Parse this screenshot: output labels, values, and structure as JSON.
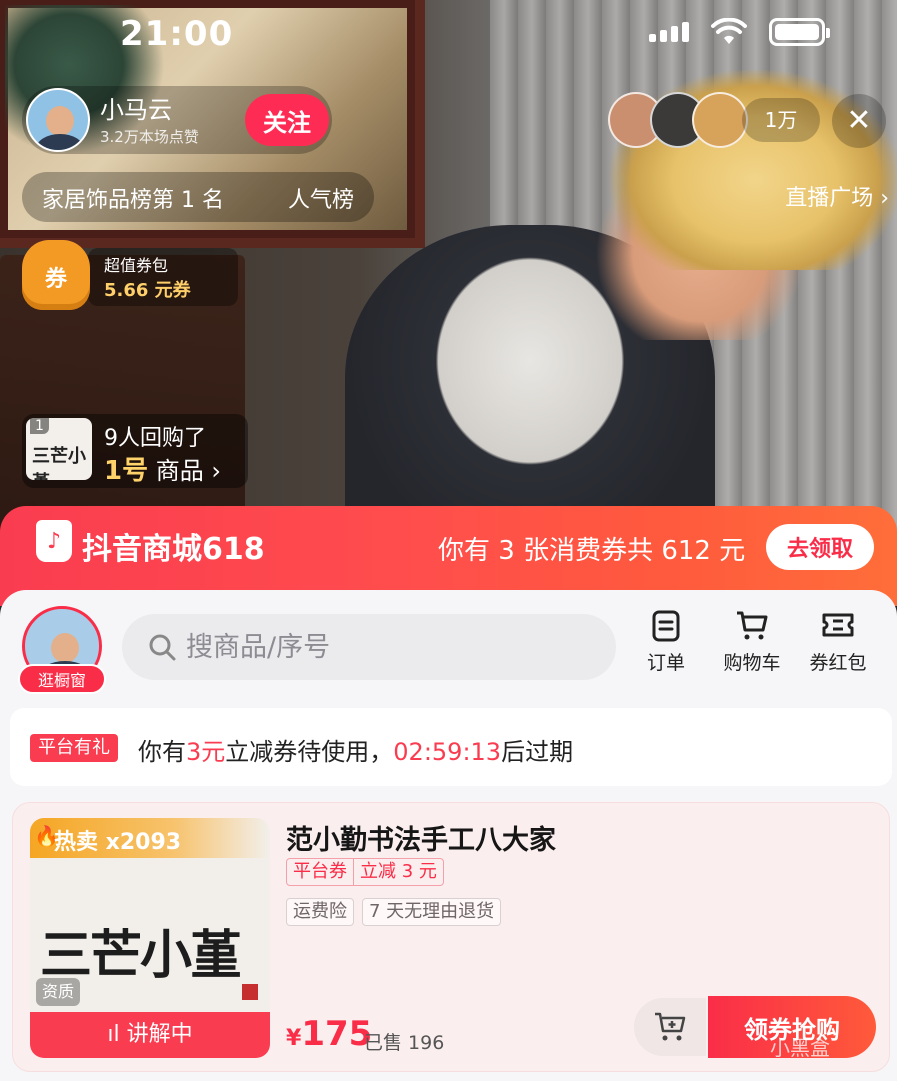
{
  "status_bar": {
    "time": "21:00"
  },
  "host": {
    "name": "小马云",
    "likes": "3.2万本场点赞",
    "follow_label": "关注"
  },
  "viewers": {
    "count": "1万"
  },
  "close_label": "✕",
  "rank": {
    "text": "家居饰品榜第 1 名",
    "popularity": "人气榜"
  },
  "plaza": "直播广场 ›",
  "coupon_pack": {
    "badge": "券",
    "title": "超值券包",
    "value": "5.66 元券"
  },
  "rebuy": {
    "thumb_num": "1",
    "thumb_ink": "三芒小堇",
    "line1": "9人回购了",
    "line2_highlight": "1号",
    "line2_rest": " 商品 ›"
  },
  "shop": {
    "name": "抖音商城618",
    "coupon_text": "你有 3 张消费券共 612 元",
    "collect_label": "去领取",
    "browse_label": "逛橱窗",
    "search_placeholder": "搜商品/序号",
    "tools": [
      "订单",
      "购物车",
      "券红包"
    ]
  },
  "notice": {
    "tag": "平台有礼",
    "prefix": "你有",
    "amount": "3元",
    "middle": "立减券待使用，",
    "countdown": "02:59:13",
    "suffix": "后过期"
  },
  "product": {
    "hot_label": "热卖 x2093",
    "image_text": "三芒小堇",
    "quality_label": "资质",
    "explaining_label": "ıl 讲解中",
    "title": "范小勤书法手工八大家",
    "coupon_type": "平台券",
    "coupon_discount": "立减 3 元",
    "services": [
      "运费险",
      "7 天无理由退货"
    ],
    "price_symbol": "¥",
    "price": "175",
    "sold": "已售 196",
    "buy_label": "领券抢购"
  },
  "watermark": "小黑盒",
  "colors": {
    "accent": "#fa2d48",
    "banner": "#fa3c50",
    "coupon_gold": "#f39a25"
  }
}
